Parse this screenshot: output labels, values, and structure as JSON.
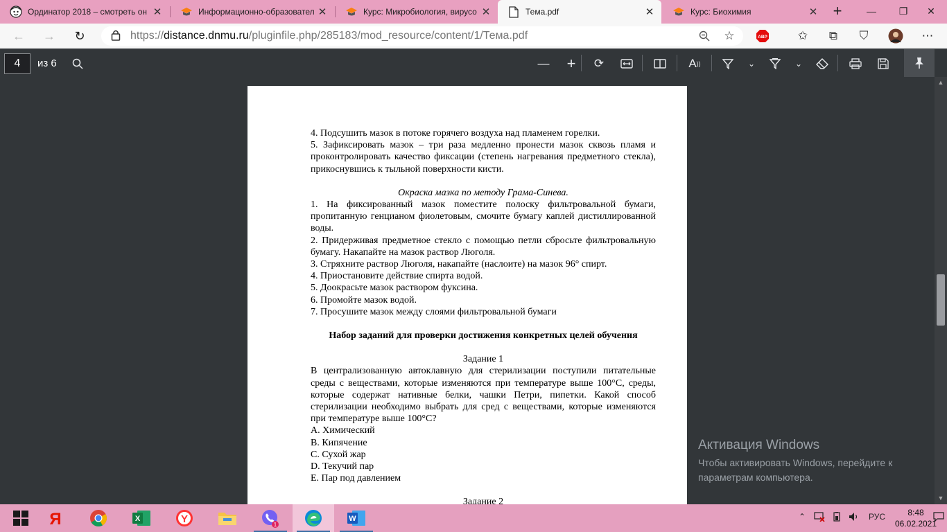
{
  "browser": {
    "tabs": [
      {
        "title": "Ординатор 2018 – смотреть он",
        "icon": "face-favicon-icon"
      },
      {
        "title": "Информационно-образовател",
        "icon": "moodle-hat-icon"
      },
      {
        "title": "Курс: Микробиология, вирусо",
        "icon": "moodle-hat-icon"
      },
      {
        "title": "Тема.pdf",
        "icon": "pdf-document-icon"
      },
      {
        "title": "Курс: Биохимия",
        "icon": "moodle-hat-icon"
      }
    ],
    "active_tab_index": 3,
    "url_scheme": "https://",
    "url_host": "distance.dnmu.ru",
    "url_path": "/pluginfile.php/285183/mod_resource/content/1/Тема.pdf",
    "abp_badge": "ABP"
  },
  "pdf_toolbar": {
    "current_page": "4",
    "total_pages_label": "из 6"
  },
  "document": {
    "lines_top": [
      "4. Подсушить мазок в потоке горячего воздуха над пламенем горелки.",
      "5. Зафиксировать мазок – три раза медленно пронести мазок сквозь пламя и проконтролировать качество фиксации (степень нагревания предметного стекла), прикоснувшись к тыльной поверхности кисти."
    ],
    "gram_heading": "Окраска мазка по методу Грама-Синева.",
    "gram_steps": [
      "1. На фиксированный мазок поместите полоску фильтровальной бумаги, пропитанную генцианом фиолетовым, смочите бумагу каплей дистиллированной воды.",
      "2. Придерживая предметное стекло с помощью петли сбросьте фильтровальную бумагу. Накапайте на мазок раствор Люголя.",
      "3. Стряхните раствор Люголя, накапайте (наслоите) на мазок 96° спирт.",
      "4. Приостановите действие спирта водой.",
      "5. Доокрасьте мазок раствором фуксина.",
      "6. Промойте мазок водой.",
      "7. Просушите мазок между слоями фильтровальной бумаги"
    ],
    "tasks_heading": "Набор заданий для проверки достижения конкретных целей обучения",
    "task1_title": "Задание 1",
    "task1_text": "В централизованную автоклавную для стерилизации поступили питательные среды с веществами, которые изменяются при температуре выше 100°С, среды, которые содержат нативные белки, чашки Петри, пипетки. Какой способ стерилизации необходимо выбрать для сред с веществами, которые изменяются при температуре выше 100°С?",
    "task1_options": [
      "А. Химический",
      "В. Кипячение",
      "С. Сухой жар",
      "D. Текучий пар",
      "Е. Пар под давлением"
    ],
    "task2_title": "Задание 2"
  },
  "watermark": {
    "title": "Активация Windows",
    "line1": "Чтобы активировать Windows, перейдите к",
    "line2": "параметрам компьютера."
  },
  "taskbar": {
    "lang": "РУС",
    "time": "8:48",
    "date": "06.02.2021",
    "viber_badge": "1"
  },
  "colors": {
    "tabstrip": "#e8a0c0",
    "taskbar": "#e5a0bf",
    "pdf_viewer_bg": "#323639"
  }
}
